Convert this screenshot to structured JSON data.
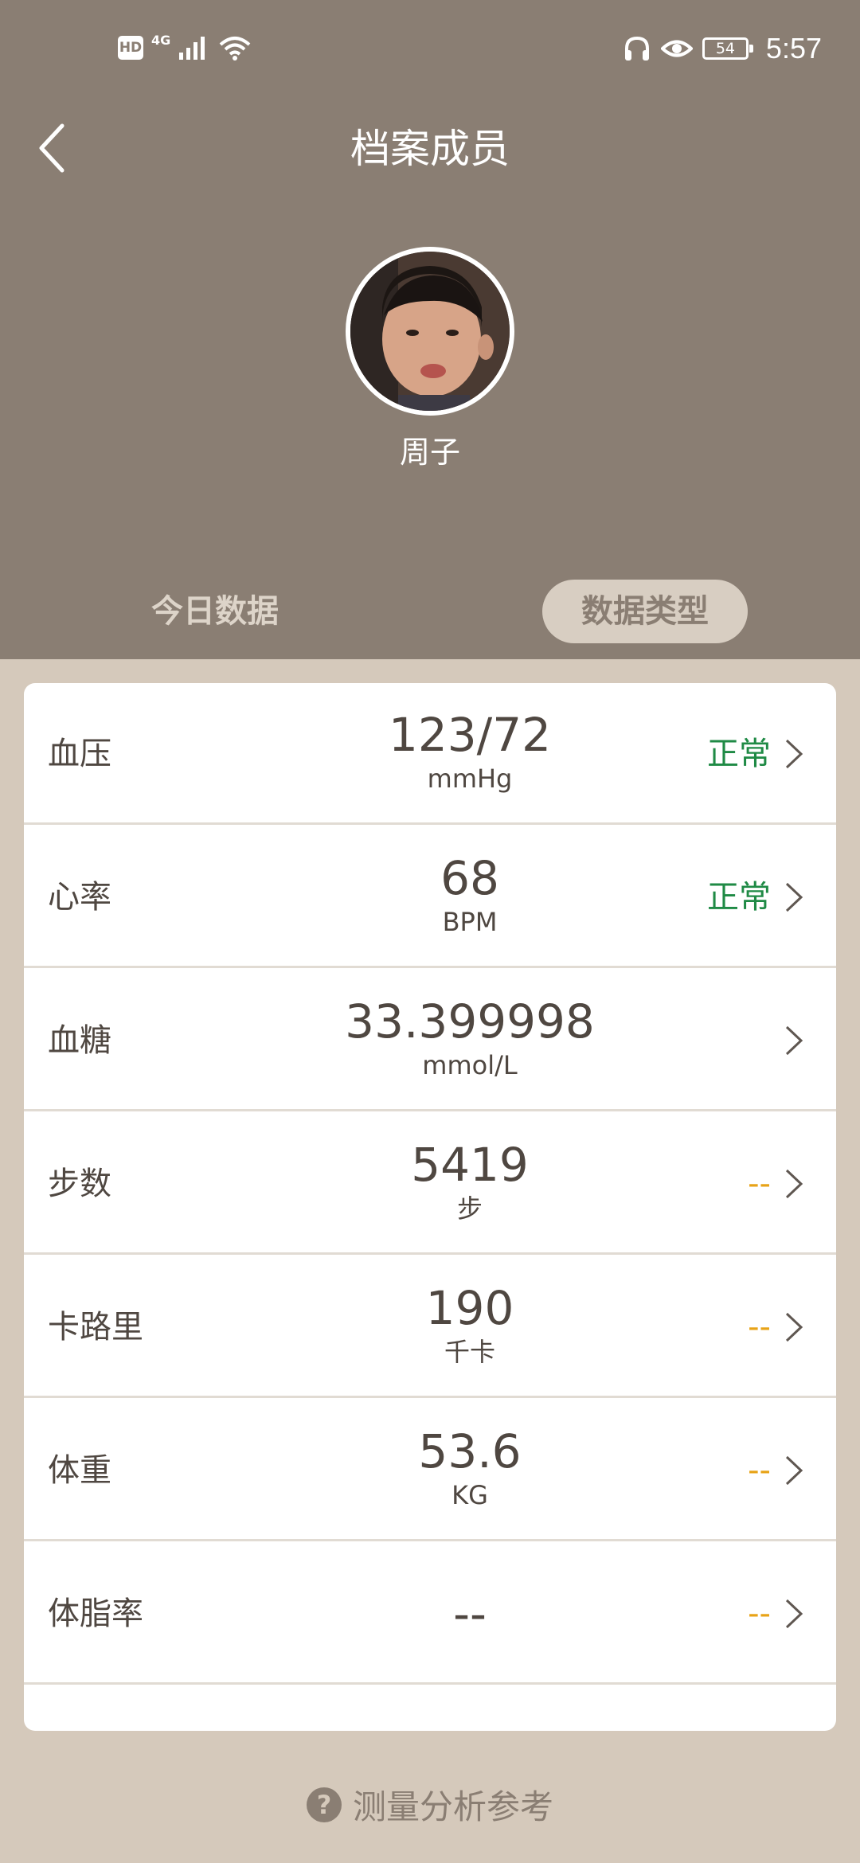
{
  "status_bar": {
    "hd": "HD",
    "network": "4G",
    "battery": "54",
    "time": "5:57"
  },
  "header": {
    "title": "档案成员",
    "member_name": "周子"
  },
  "tabs": {
    "today": "今日数据",
    "data_type": "数据类型"
  },
  "metrics": [
    {
      "label": "血压",
      "value": "123/72",
      "unit": "mmHg",
      "status": "正常",
      "status_kind": "normal"
    },
    {
      "label": "心率",
      "value": "68",
      "unit": "BPM",
      "status": "正常",
      "status_kind": "normal"
    },
    {
      "label": "血糖",
      "value": "33.399998",
      "unit": "mmol/L",
      "status": "",
      "status_kind": "none"
    },
    {
      "label": "步数",
      "value": "5419",
      "unit": "步",
      "status": "--",
      "status_kind": "none"
    },
    {
      "label": "卡路里",
      "value": "190",
      "unit": "千卡",
      "status": "--",
      "status_kind": "none"
    },
    {
      "label": "体重",
      "value": "53.6",
      "unit": "KG",
      "status": "--",
      "status_kind": "none"
    },
    {
      "label": "体脂率",
      "value": "--",
      "unit": "",
      "status": "--",
      "status_kind": "none"
    }
  ],
  "footer": {
    "help_label": "测量分析参考"
  },
  "colors": {
    "header_bg": "#8a7e73",
    "page_bg": "#d5c9bb",
    "normal": "#1f8a45",
    "no_data": "#e8a317"
  }
}
